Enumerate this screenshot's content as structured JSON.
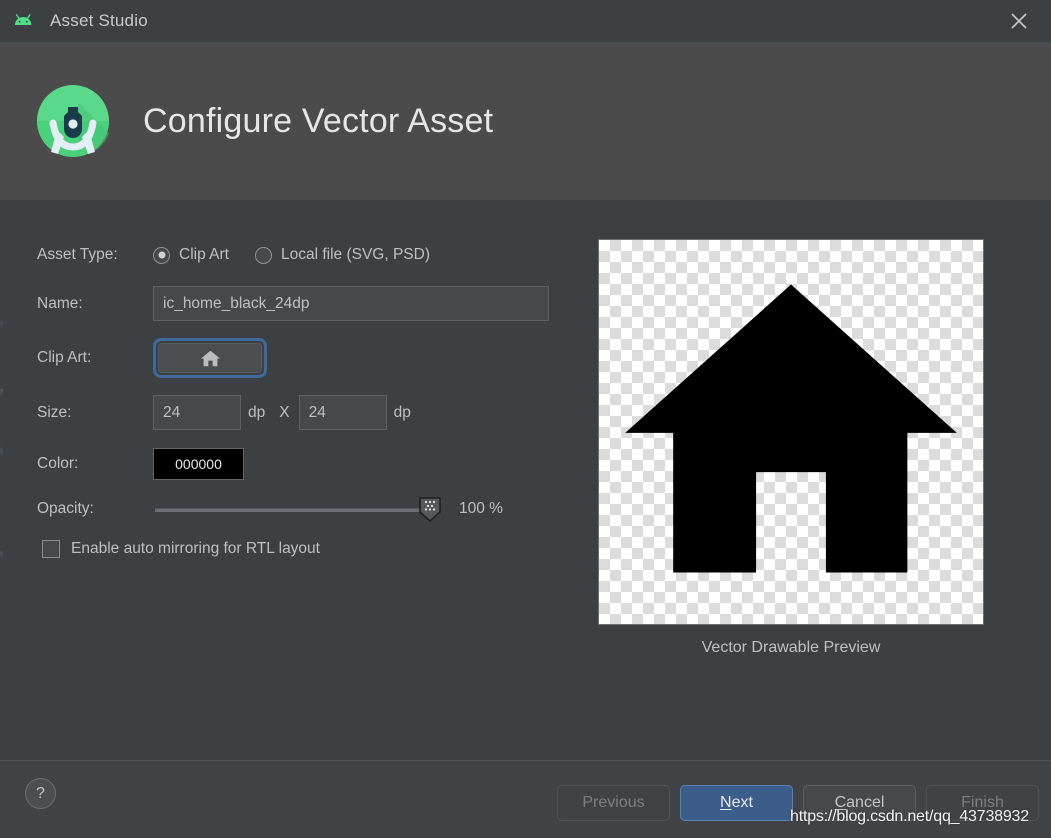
{
  "window": {
    "title": "Asset Studio",
    "app_icon": "android-robot-icon",
    "close_icon": "close-icon"
  },
  "header": {
    "title": "Configure Vector Asset",
    "logo": "android-studio-logo"
  },
  "form": {
    "asset_type": {
      "label": "Asset Type:",
      "options": [
        {
          "label": "Clip Art",
          "selected": true
        },
        {
          "label": "Local file (SVG, PSD)",
          "selected": false
        }
      ]
    },
    "name": {
      "label": "Name:",
      "value": "ic_home_black_24dp",
      "placeholder": "Name"
    },
    "clip_art": {
      "label": "Clip Art:",
      "icon": "home-icon",
      "focused": true
    },
    "size": {
      "label": "Size:",
      "width_value": "24",
      "height_value": "24",
      "unit": "dp",
      "separator": "X"
    },
    "color": {
      "label": "Color:",
      "value": "000000",
      "hex": "#000000"
    },
    "opacity": {
      "label": "Opacity:",
      "value": 100,
      "display": "100 %"
    },
    "mirroring": {
      "label": "Enable auto mirroring for RTL layout",
      "checked": false
    }
  },
  "preview": {
    "caption": "Vector Drawable Preview",
    "icon": "home-icon",
    "icon_color": "#000000"
  },
  "footer": {
    "help_label": "?",
    "buttons": [
      {
        "name": "previous",
        "label": "Previous",
        "mnemonic": "",
        "state": "disabled"
      },
      {
        "name": "next",
        "label": "ext",
        "mnemonic": "N",
        "state": "primary"
      },
      {
        "name": "cancel",
        "label": "ancel",
        "mnemonic": "C",
        "state": "normal"
      },
      {
        "name": "finish",
        "label": "Finish",
        "mnemonic": "",
        "state": "disabled"
      }
    ]
  },
  "watermark": {
    "text": "https://blog.csdn.net/qq_43738932"
  },
  "colors": {
    "header_bg": "#4b4b4b",
    "body_bg": "#3c4043",
    "accent_blue": "#3c5c89",
    "focus_blue": "#3f6a99",
    "android_green": "#3ddc84"
  }
}
